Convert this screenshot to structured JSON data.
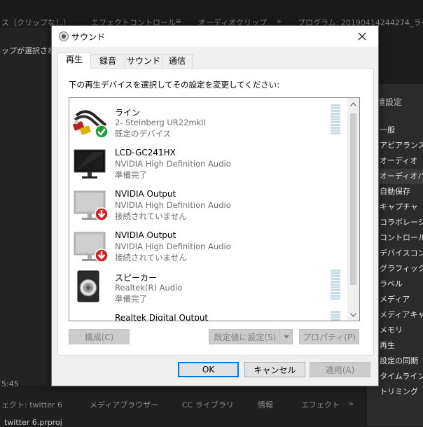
{
  "background": {
    "top_tabs": [
      "ス（クリップなし）",
      "エフェクトコントロール",
      "≡",
      "オーディオクリップ",
      "»",
      "プログラム: 20190414244274_ライ"
    ],
    "clip_message": "ップが選択されて",
    "timecode": "5:45",
    "bottom_tabs": [
      "ェクト: twitter 6",
      "メディアブラウザー",
      "CC ライブラリ",
      "情報",
      "エフェクト",
      "»"
    ],
    "project_file": "twitter 6.prproj",
    "preferences": {
      "title": "境設定",
      "items": [
        "一般",
        "アピアランス",
        "オーディオ",
        "オーディオハ",
        "自動保存",
        "キャプチャ",
        "コラボレーシ",
        "コントロール",
        "デバイスコン",
        "グラフィック",
        "ラベル",
        "メディア",
        "メディアキャ",
        "メモリ",
        "再生",
        "設定の同期",
        "タイムライン",
        "トリミング"
      ],
      "selected_index": 3
    }
  },
  "dialog": {
    "title": "サウンド",
    "tabs": [
      "再生",
      "録音",
      "サウンド",
      "通信"
    ],
    "active_tab": 0,
    "instruction": "下の再生デバイスを選択してその設定を変更してください:",
    "devices": [
      {
        "name": "ライン",
        "sub": "2- Steinberg UR22mkII",
        "status": "既定のデバイス",
        "icon": "line-cable-icon",
        "badge": "check",
        "meter": true
      },
      {
        "name": "LCD-GC241HX",
        "sub": "NVIDIA High Definition Audio",
        "status": "準備完了",
        "icon": "monitor-icon",
        "badge": "",
        "meter": false
      },
      {
        "name": "NVIDIA Output",
        "sub": "NVIDIA High Definition Audio",
        "status": "接続されていません",
        "icon": "monitor-disconnected-icon",
        "badge": "down",
        "meter": false
      },
      {
        "name": "NVIDIA Output",
        "sub": "NVIDIA High Definition Audio",
        "status": "接続されていません",
        "icon": "monitor-disconnected-icon",
        "badge": "down",
        "meter": false
      },
      {
        "name": "スピーカー",
        "sub": "Realtek(R) Audio",
        "status": "準備完了",
        "icon": "speaker-icon",
        "badge": "",
        "meter": true
      },
      {
        "name": "Realtek Digital Output",
        "sub": "",
        "status": "",
        "icon": "digital-output-icon",
        "badge": "",
        "meter": true
      }
    ],
    "buttons": {
      "configure": "構成(C)",
      "set_default": "既定値に設定(S)",
      "properties": "プロパティ(P)",
      "ok": "OK",
      "cancel": "キャンセル",
      "apply": "適用(A)"
    },
    "colors": {
      "check_badge": "#1f9e3a",
      "down_badge": "#d31f1f",
      "accent": "#0078d7"
    }
  }
}
